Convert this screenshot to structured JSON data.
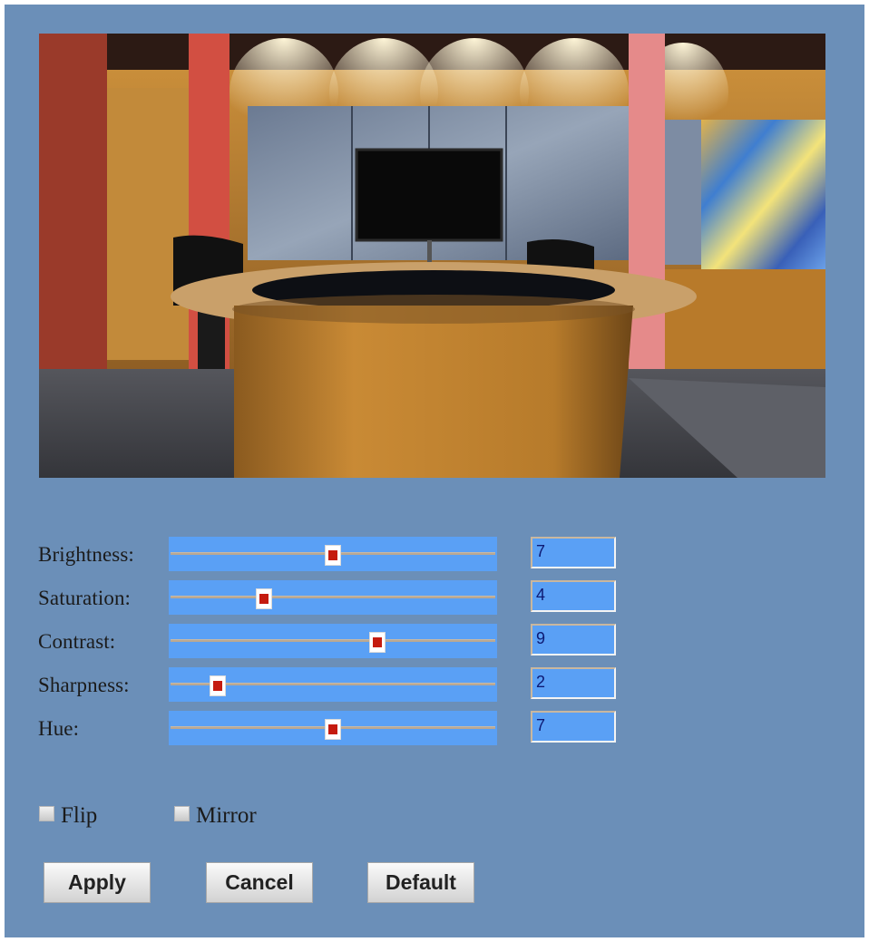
{
  "preview": {
    "name": "camera-preview"
  },
  "sliders": [
    {
      "id": "brightness",
      "label": "Brightness:",
      "value": "7",
      "level": 0.5
    },
    {
      "id": "saturation",
      "label": "Saturation:",
      "value": "4",
      "level": 0.29
    },
    {
      "id": "contrast",
      "label": "Contrast:",
      "value": "9",
      "level": 0.635
    },
    {
      "id": "sharpness",
      "label": "Sharpness:",
      "value": "2",
      "level": 0.15
    },
    {
      "id": "hue",
      "label": "Hue:",
      "value": "7",
      "level": 0.5
    }
  ],
  "options": {
    "flip": {
      "label": "Flip",
      "checked": false
    },
    "mirror": {
      "label": "Mirror",
      "checked": false
    }
  },
  "buttons": {
    "apply": "Apply",
    "cancel": "Cancel",
    "default": "Default"
  },
  "colors": {
    "panel": "#6b8fb8",
    "slider_track": "#5aa0f5",
    "slider_thumb": "#c51b0f",
    "value_text": "#0d1a73"
  }
}
